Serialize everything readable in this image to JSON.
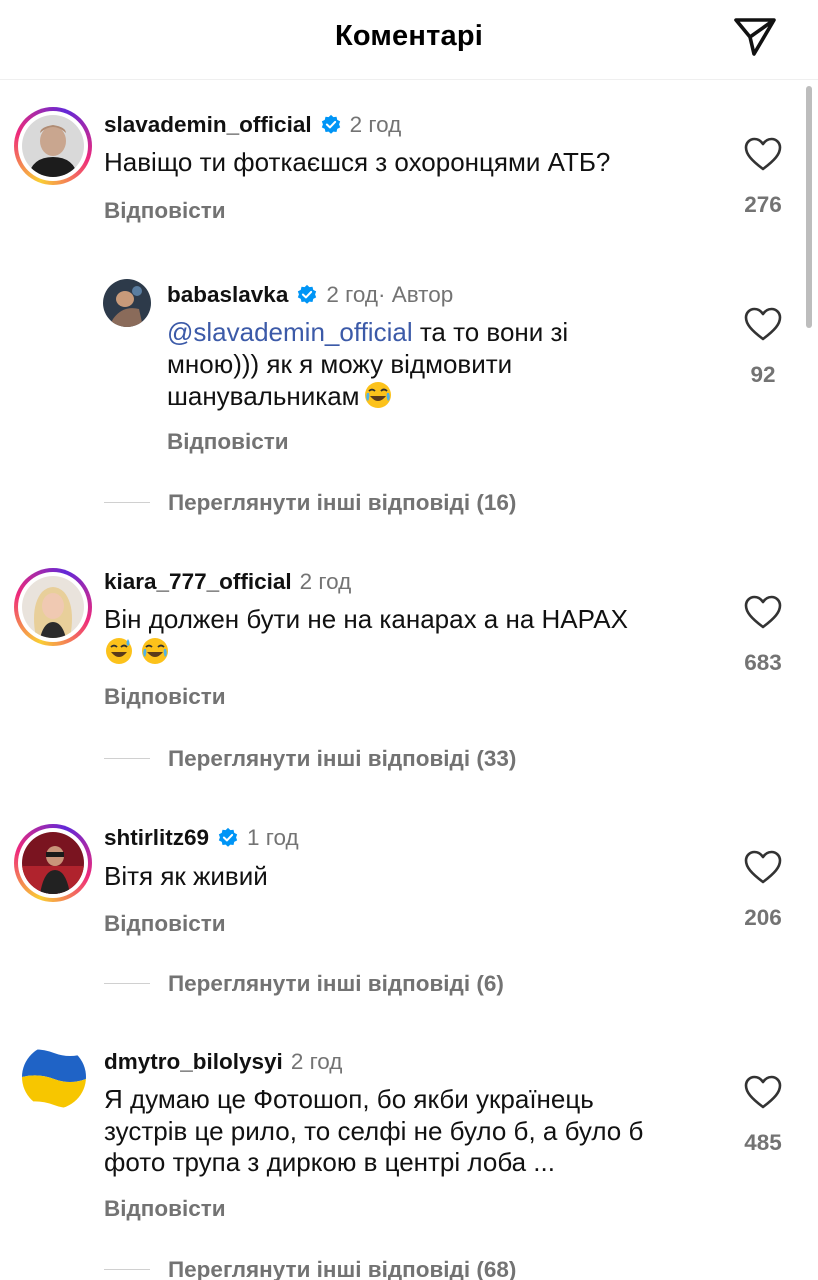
{
  "header": {
    "title": "Коментарі"
  },
  "reply_label": "Відповісти",
  "comments": [
    {
      "username": "slavademin_official",
      "verified": true,
      "time": "2 год",
      "text": "Навіщо ти фоткаєшся з охоронцями АТБ?",
      "likes": "276"
    },
    {
      "username": "babaslavka",
      "verified": true,
      "time": "2 год",
      "author_label": " · Автор",
      "mention": "@slavademin_official",
      "text_after_mention": " та то вони зі\nмною))) як я можу відмовити\nшанувальникам",
      "emoji": "😂",
      "likes": "92",
      "more_replies": "Переглянути інші відповіді (16)"
    },
    {
      "username": "kiara_777_official",
      "verified": false,
      "time": "2 год",
      "text": "Він должен бути не на канарах а на НАРАХ",
      "emoji_line": "😅 😂",
      "likes": "683",
      "more_replies": "Переглянути інші відповіді (33)"
    },
    {
      "username": "shtirlitz69",
      "verified": true,
      "time": "1 год",
      "text": "Вітя як живий",
      "likes": "206",
      "more_replies": "Переглянути інші відповіді (6)"
    },
    {
      "username": "dmytro_bilolysyi",
      "verified": false,
      "time": "2 год",
      "text": "Я думаю це Фотошоп, бо якби українець\nзустрів це рило, то селфі не було б, а було б\nфото трупа з диркою в центрі лоба ...",
      "likes": "485",
      "more_replies": "Переглянути інші відповіді (68)"
    }
  ],
  "colors": {
    "secondary_text": "#737373",
    "mention": "#3c5aa8",
    "verified": "#0095f6"
  }
}
